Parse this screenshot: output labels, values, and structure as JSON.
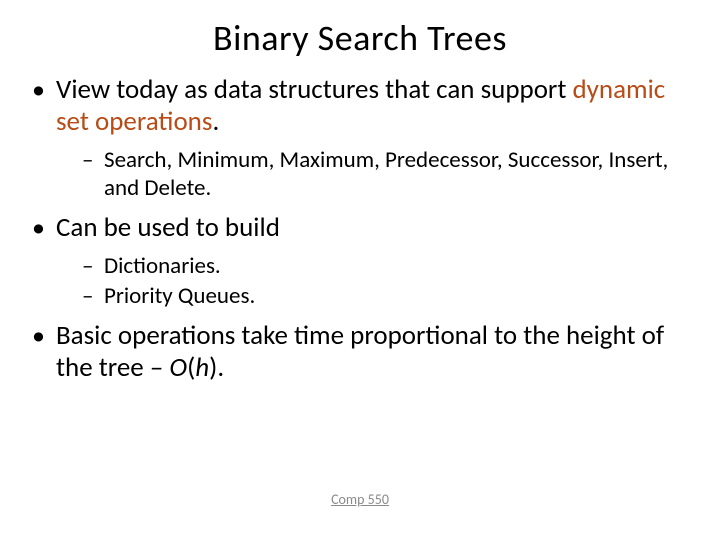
{
  "title": "Binary Search Trees",
  "bullets": {
    "b1_pre": "View today as data structures that can support ",
    "b1_accent": "dynamic set operations",
    "b1_post": ".",
    "b1_sub1": "Search, Minimum, Maximum, Predecessor, Successor, Insert, and Delete.",
    "b2": "Can be used to build",
    "b2_sub1": "Dictionaries.",
    "b2_sub2": "Priority Queues.",
    "b3_pre": "Basic operations take time proportional to the height of the tree – ",
    "b3_o": "O",
    "b3_paren_open": "(",
    "b3_h": "h",
    "b3_paren_close_post": ")."
  },
  "footer": "Comp 550"
}
